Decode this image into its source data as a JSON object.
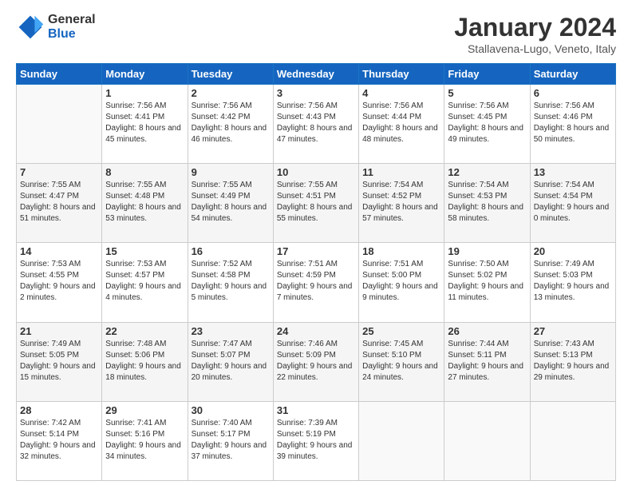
{
  "logo": {
    "general": "General",
    "blue": "Blue"
  },
  "title": "January 2024",
  "subtitle": "Stallavena-Lugo, Veneto, Italy",
  "days_of_week": [
    "Sunday",
    "Monday",
    "Tuesday",
    "Wednesday",
    "Thursday",
    "Friday",
    "Saturday"
  ],
  "weeks": [
    [
      {
        "num": "",
        "sunrise": "",
        "sunset": "",
        "daylight": "",
        "empty": true
      },
      {
        "num": "1",
        "sunrise": "Sunrise: 7:56 AM",
        "sunset": "Sunset: 4:41 PM",
        "daylight": "Daylight: 8 hours and 45 minutes."
      },
      {
        "num": "2",
        "sunrise": "Sunrise: 7:56 AM",
        "sunset": "Sunset: 4:42 PM",
        "daylight": "Daylight: 8 hours and 46 minutes."
      },
      {
        "num": "3",
        "sunrise": "Sunrise: 7:56 AM",
        "sunset": "Sunset: 4:43 PM",
        "daylight": "Daylight: 8 hours and 47 minutes."
      },
      {
        "num": "4",
        "sunrise": "Sunrise: 7:56 AM",
        "sunset": "Sunset: 4:44 PM",
        "daylight": "Daylight: 8 hours and 48 minutes."
      },
      {
        "num": "5",
        "sunrise": "Sunrise: 7:56 AM",
        "sunset": "Sunset: 4:45 PM",
        "daylight": "Daylight: 8 hours and 49 minutes."
      },
      {
        "num": "6",
        "sunrise": "Sunrise: 7:56 AM",
        "sunset": "Sunset: 4:46 PM",
        "daylight": "Daylight: 8 hours and 50 minutes."
      }
    ],
    [
      {
        "num": "7",
        "sunrise": "Sunrise: 7:55 AM",
        "sunset": "Sunset: 4:47 PM",
        "daylight": "Daylight: 8 hours and 51 minutes."
      },
      {
        "num": "8",
        "sunrise": "Sunrise: 7:55 AM",
        "sunset": "Sunset: 4:48 PM",
        "daylight": "Daylight: 8 hours and 53 minutes."
      },
      {
        "num": "9",
        "sunrise": "Sunrise: 7:55 AM",
        "sunset": "Sunset: 4:49 PM",
        "daylight": "Daylight: 8 hours and 54 minutes."
      },
      {
        "num": "10",
        "sunrise": "Sunrise: 7:55 AM",
        "sunset": "Sunset: 4:51 PM",
        "daylight": "Daylight: 8 hours and 55 minutes."
      },
      {
        "num": "11",
        "sunrise": "Sunrise: 7:54 AM",
        "sunset": "Sunset: 4:52 PM",
        "daylight": "Daylight: 8 hours and 57 minutes."
      },
      {
        "num": "12",
        "sunrise": "Sunrise: 7:54 AM",
        "sunset": "Sunset: 4:53 PM",
        "daylight": "Daylight: 8 hours and 58 minutes."
      },
      {
        "num": "13",
        "sunrise": "Sunrise: 7:54 AM",
        "sunset": "Sunset: 4:54 PM",
        "daylight": "Daylight: 9 hours and 0 minutes."
      }
    ],
    [
      {
        "num": "14",
        "sunrise": "Sunrise: 7:53 AM",
        "sunset": "Sunset: 4:55 PM",
        "daylight": "Daylight: 9 hours and 2 minutes."
      },
      {
        "num": "15",
        "sunrise": "Sunrise: 7:53 AM",
        "sunset": "Sunset: 4:57 PM",
        "daylight": "Daylight: 9 hours and 4 minutes."
      },
      {
        "num": "16",
        "sunrise": "Sunrise: 7:52 AM",
        "sunset": "Sunset: 4:58 PM",
        "daylight": "Daylight: 9 hours and 5 minutes."
      },
      {
        "num": "17",
        "sunrise": "Sunrise: 7:51 AM",
        "sunset": "Sunset: 4:59 PM",
        "daylight": "Daylight: 9 hours and 7 minutes."
      },
      {
        "num": "18",
        "sunrise": "Sunrise: 7:51 AM",
        "sunset": "Sunset: 5:00 PM",
        "daylight": "Daylight: 9 hours and 9 minutes."
      },
      {
        "num": "19",
        "sunrise": "Sunrise: 7:50 AM",
        "sunset": "Sunset: 5:02 PM",
        "daylight": "Daylight: 9 hours and 11 minutes."
      },
      {
        "num": "20",
        "sunrise": "Sunrise: 7:49 AM",
        "sunset": "Sunset: 5:03 PM",
        "daylight": "Daylight: 9 hours and 13 minutes."
      }
    ],
    [
      {
        "num": "21",
        "sunrise": "Sunrise: 7:49 AM",
        "sunset": "Sunset: 5:05 PM",
        "daylight": "Daylight: 9 hours and 15 minutes."
      },
      {
        "num": "22",
        "sunrise": "Sunrise: 7:48 AM",
        "sunset": "Sunset: 5:06 PM",
        "daylight": "Daylight: 9 hours and 18 minutes."
      },
      {
        "num": "23",
        "sunrise": "Sunrise: 7:47 AM",
        "sunset": "Sunset: 5:07 PM",
        "daylight": "Daylight: 9 hours and 20 minutes."
      },
      {
        "num": "24",
        "sunrise": "Sunrise: 7:46 AM",
        "sunset": "Sunset: 5:09 PM",
        "daylight": "Daylight: 9 hours and 22 minutes."
      },
      {
        "num": "25",
        "sunrise": "Sunrise: 7:45 AM",
        "sunset": "Sunset: 5:10 PM",
        "daylight": "Daylight: 9 hours and 24 minutes."
      },
      {
        "num": "26",
        "sunrise": "Sunrise: 7:44 AM",
        "sunset": "Sunset: 5:11 PM",
        "daylight": "Daylight: 9 hours and 27 minutes."
      },
      {
        "num": "27",
        "sunrise": "Sunrise: 7:43 AM",
        "sunset": "Sunset: 5:13 PM",
        "daylight": "Daylight: 9 hours and 29 minutes."
      }
    ],
    [
      {
        "num": "28",
        "sunrise": "Sunrise: 7:42 AM",
        "sunset": "Sunset: 5:14 PM",
        "daylight": "Daylight: 9 hours and 32 minutes."
      },
      {
        "num": "29",
        "sunrise": "Sunrise: 7:41 AM",
        "sunset": "Sunset: 5:16 PM",
        "daylight": "Daylight: 9 hours and 34 minutes."
      },
      {
        "num": "30",
        "sunrise": "Sunrise: 7:40 AM",
        "sunset": "Sunset: 5:17 PM",
        "daylight": "Daylight: 9 hours and 37 minutes."
      },
      {
        "num": "31",
        "sunrise": "Sunrise: 7:39 AM",
        "sunset": "Sunset: 5:19 PM",
        "daylight": "Daylight: 9 hours and 39 minutes."
      },
      {
        "num": "",
        "sunrise": "",
        "sunset": "",
        "daylight": "",
        "empty": true
      },
      {
        "num": "",
        "sunrise": "",
        "sunset": "",
        "daylight": "",
        "empty": true
      },
      {
        "num": "",
        "sunrise": "",
        "sunset": "",
        "daylight": "",
        "empty": true
      }
    ]
  ]
}
